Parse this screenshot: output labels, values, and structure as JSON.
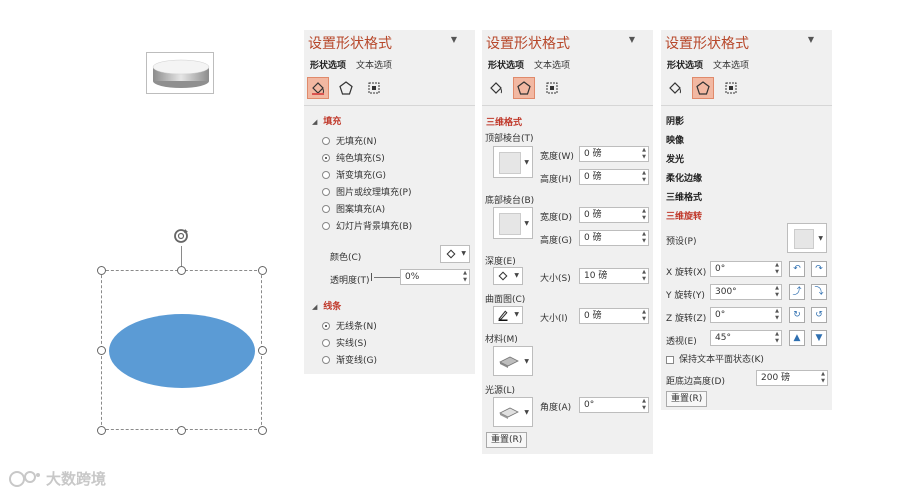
{
  "panel": {
    "title": "设置形状格式",
    "close_glyph": "▼",
    "tab_shape": "形状选项",
    "tab_text": "文本选项"
  },
  "fill_panel": {
    "fill_section": "填充",
    "options": [
      "无填充(N)",
      "纯色填充(S)",
      "渐变填充(G)",
      "图片或纹理填充(P)",
      "图案填充(A)",
      "幻灯片背景填充(B)"
    ],
    "selected_option": "纯色填充(S)",
    "color_label": "颜色(C)",
    "transparency_label": "透明度(T)",
    "transparency_value": "0%",
    "line_section": "线条",
    "line_options": [
      "无线条(N)",
      "实线(S)",
      "渐变线(G)"
    ],
    "selected_line": "无线条(N)"
  },
  "threed_format_panel": {
    "section": "三维格式",
    "top_bevel": "顶部棱台(T)",
    "bottom_bevel": "底部棱台(B)",
    "width_label": "宽度(W)",
    "height_label": "高度(H)",
    "width_label_b": "宽度(D)",
    "height_label_b": "高度(G)",
    "top_width": "0 磅",
    "top_height": "0 磅",
    "bottom_width": "0 磅",
    "bottom_height": "0 磅",
    "depth_label": "深度(E)",
    "depth_size_label": "大小(S)",
    "depth_size": "10 磅",
    "contour_label": "曲面图(C)",
    "contour_size_label": "大小(I)",
    "contour_size": "0 磅",
    "material_label": "材料(M)",
    "lighting_label": "光源(L)",
    "angle_label": "角度(A)",
    "angle_value": "0°",
    "reset": "重置(R)"
  },
  "threed_rotation_panel": {
    "sections": [
      "阴影",
      "映像",
      "发光",
      "柔化边缘",
      "三维格式"
    ],
    "active_section": "三维旋转",
    "preset_label": "预设(P)",
    "x_label": "X 旋转(X)",
    "x_value": "0°",
    "y_label": "Y 旋转(Y)",
    "y_value": "300°",
    "z_label": "Z 旋转(Z)",
    "z_value": "0°",
    "perspective_label": "透视(E)",
    "perspective_value": "45°",
    "keep_text_flat": "保持文本平面状态(K)",
    "distance_label": "距底边高度(D)",
    "distance_value": "200 磅",
    "reset": "重置(R)"
  },
  "watermark": {
    "text": "大数跨境"
  },
  "colors": {
    "shape_fill": "#5b9bd5",
    "title_red": "#b7472a",
    "selected_icon_bg": "#f2b8a2",
    "panel_bg": "#f0f0f0"
  }
}
